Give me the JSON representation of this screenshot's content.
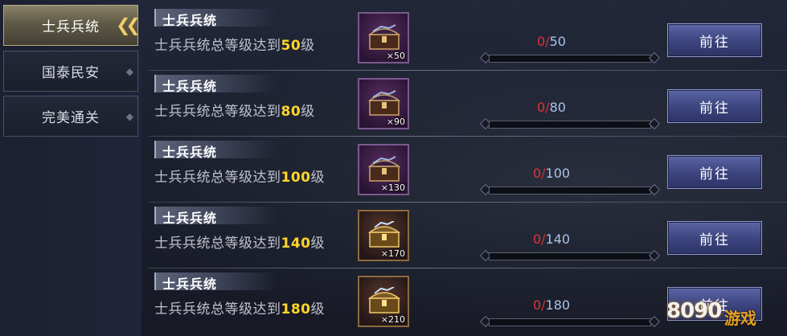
{
  "sidebar": {
    "tabs": [
      {
        "label": "士兵兵统",
        "active": true
      },
      {
        "label": "国泰民安",
        "active": false
      },
      {
        "label": "完美通关",
        "active": false
      }
    ]
  },
  "tasks": [
    {
      "title": "士兵兵统",
      "desc_prefix": "士兵兵统总等级达到",
      "level": "50",
      "desc_suffix": "级",
      "reward_qty": "×50",
      "current": "0",
      "slash": "/",
      "target": "50",
      "button_label": "前往",
      "icon": "purple-chest-icon"
    },
    {
      "title": "士兵兵统",
      "desc_prefix": "士兵兵统总等级达到",
      "level": "80",
      "desc_suffix": "级",
      "reward_qty": "×90",
      "current": "0",
      "slash": "/",
      "target": "80",
      "button_label": "前往",
      "icon": "purple-chest-icon"
    },
    {
      "title": "士兵兵统",
      "desc_prefix": "士兵兵统总等级达到",
      "level": "100",
      "desc_suffix": "级",
      "reward_qty": "×130",
      "current": "0",
      "slash": "/",
      "target": "100",
      "button_label": "前往",
      "icon": "purple-chest-icon"
    },
    {
      "title": "士兵兵统",
      "desc_prefix": "士兵兵统总等级达到",
      "level": "140",
      "desc_suffix": "级",
      "reward_qty": "×170",
      "current": "0",
      "slash": "/",
      "target": "140",
      "button_label": "前往",
      "icon": "gold-chest-icon"
    },
    {
      "title": "士兵兵统",
      "desc_prefix": "士兵兵统总等级达到",
      "level": "180",
      "desc_suffix": "级",
      "reward_qty": "×210",
      "current": "0",
      "slash": "/",
      "target": "180",
      "button_label": "前往",
      "icon": "gold-chest-icon"
    }
  ],
  "watermark": {
    "number": "8090",
    "text": "游戏"
  },
  "colors": {
    "accent_gold": "#ffd52a",
    "progress_red": "#e0343a",
    "progress_blue": "#a9c2e8",
    "button_blue": "#3d4680"
  }
}
